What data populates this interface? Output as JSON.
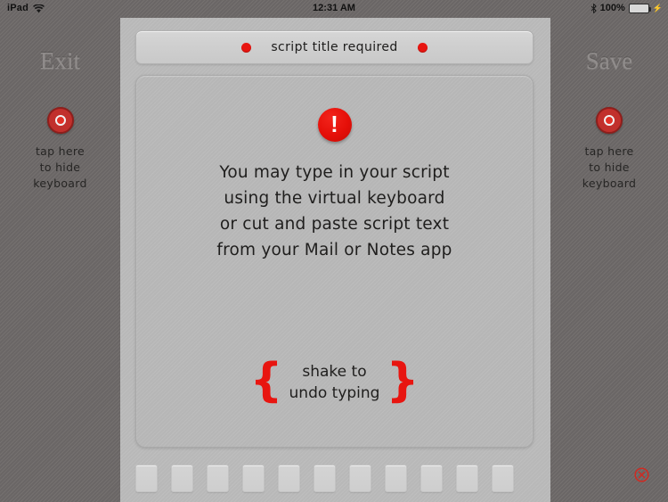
{
  "status_bar": {
    "device": "iPad",
    "wifi_icon": "wifi-icon",
    "time": "12:31 AM",
    "bluetooth_icon": "bluetooth-icon",
    "battery_percent": "100%",
    "battery_icon": "battery-full-icon",
    "charging_icon": "power-plug-icon",
    "battery_color": "#53e552"
  },
  "chrome": {
    "exit_label": "Exit",
    "save_label": "Save",
    "hide_keyboard_icon": "target-dot-icon",
    "hide_keyboard_lines": [
      "tap here",
      "to hide",
      "keyboard"
    ]
  },
  "title_bar": {
    "text": "script title required",
    "dot_icon": "red-dot-icon",
    "dot_color": "#e81510"
  },
  "text_panel": {
    "alert_icon": "alert-exclamation-icon",
    "alert_color": "#e50f08",
    "body_lines": [
      "You may type in your script",
      "using the virtual keyboard",
      "or cut and paste script text",
      "from your Mail or Notes app"
    ],
    "shake_brace_left": "{",
    "shake_brace_right": "}",
    "shake_lines": [
      "shake to",
      "undo typing"
    ],
    "brace_color": "#e81510"
  },
  "keyboard_bar": {
    "keys": [
      "",
      "",
      "",
      "",
      "",
      "",
      "",
      "",
      "",
      "",
      ""
    ],
    "dismiss_icon": "circle-x-icon",
    "dismiss_color": "#cf2a22"
  }
}
